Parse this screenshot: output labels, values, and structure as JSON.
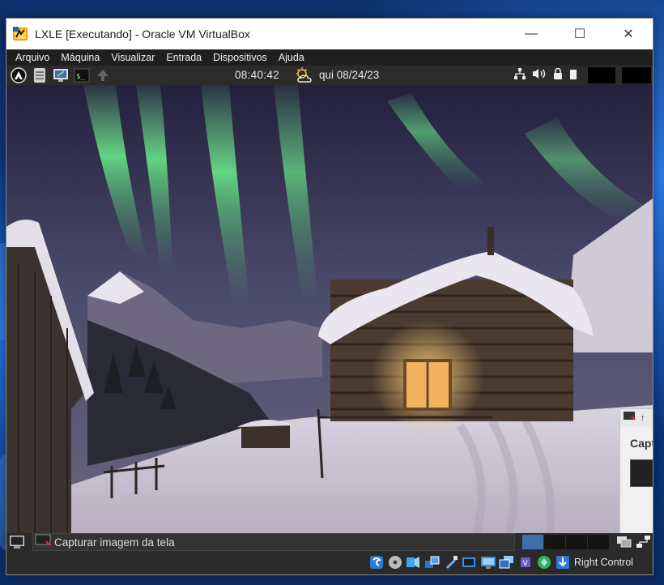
{
  "window": {
    "title": "LXLE [Executando] - Oracle VM VirtualBox",
    "controls": {
      "minimize": "—",
      "maximize": "☐",
      "close": "✕"
    }
  },
  "menu": {
    "items": [
      "Arquivo",
      "Máquina",
      "Visualizar",
      "Entrada",
      "Dispositivos",
      "Ajuda"
    ]
  },
  "guest_panel": {
    "time": "08:40:42",
    "date": "qui 08/24/23",
    "launcher_icons": [
      "lxle-logo-icon",
      "file-manager-icon",
      "display-settings-icon",
      "terminal-icon",
      "arrow-up-icon"
    ],
    "terminal_glyph": "$_",
    "weather_icon": "partly-cloudy-icon",
    "tray_icons": [
      "network-icon",
      "volume-icon",
      "lock-icon",
      "battery-icon"
    ]
  },
  "notification": {
    "title": "Capt",
    "arrow": "↑"
  },
  "guest_taskbar": {
    "task_label": "Capturar imagem da tela",
    "workspaces": 4
  },
  "statusbar": {
    "icons": [
      "optical-disk-icon",
      "hard-disk-icon",
      "audio-icon",
      "network-adapter-icon",
      "usb-icon",
      "shared-folders-icon",
      "display-icon",
      "video-capture-icon",
      "cpu-icon",
      "mouse-integration-icon",
      "host-key-icon"
    ],
    "host_key": "Right Control"
  },
  "colors": {
    "accent": "#3d6fb3",
    "panel_bg": "#2b2b2b",
    "menubar_bg": "#1f1f1f"
  }
}
